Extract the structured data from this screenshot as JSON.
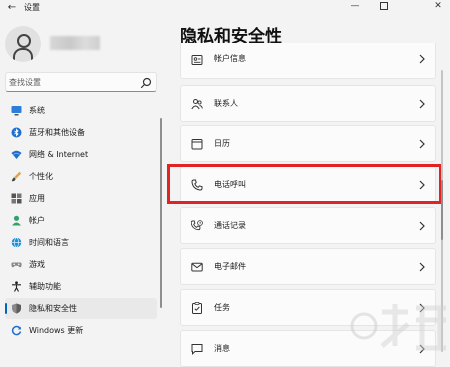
{
  "window": {
    "title": "设置",
    "back_glyph": "←",
    "min_glyph": "—",
    "close_glyph": "✕"
  },
  "search": {
    "placeholder": "查找设置"
  },
  "sidebar": {
    "items": [
      {
        "label": "系统",
        "icon": "system-icon",
        "active": false
      },
      {
        "label": "蓝牙和其他设备",
        "icon": "bluetooth-icon",
        "active": false
      },
      {
        "label": "网络 & Internet",
        "icon": "wifi-icon",
        "active": false
      },
      {
        "label": "个性化",
        "icon": "brush-icon",
        "active": false
      },
      {
        "label": "应用",
        "icon": "apps-icon",
        "active": false
      },
      {
        "label": "帐户",
        "icon": "account-icon",
        "active": false
      },
      {
        "label": "时间和语言",
        "icon": "globe-clock-icon",
        "active": false
      },
      {
        "label": "游戏",
        "icon": "gamepad-icon",
        "active": false
      },
      {
        "label": "辅助功能",
        "icon": "accessibility-icon",
        "active": false
      },
      {
        "label": "隐私和安全性",
        "icon": "shield-icon",
        "active": true
      },
      {
        "label": "Windows 更新",
        "icon": "update-icon",
        "active": false
      }
    ]
  },
  "main": {
    "title": "隐私和安全性",
    "cards": [
      {
        "label": "帐户信息",
        "icon": "account-info-icon"
      },
      {
        "label": "联系人",
        "icon": "contacts-icon"
      },
      {
        "label": "日历",
        "icon": "calendar-icon"
      },
      {
        "label": "电话呼叫",
        "icon": "phone-icon"
      },
      {
        "label": "通话记录",
        "icon": "call-history-icon"
      },
      {
        "label": "电子邮件",
        "icon": "mail-icon"
      },
      {
        "label": "任务",
        "icon": "tasks-icon"
      },
      {
        "label": "消息",
        "icon": "message-icon"
      }
    ],
    "highlighted_card": "电话呼叫"
  },
  "colors": {
    "accent": "#0067c0",
    "highlight_border": "#e02424",
    "background": "#f3f3f3",
    "card": "#fbfbfb"
  }
}
